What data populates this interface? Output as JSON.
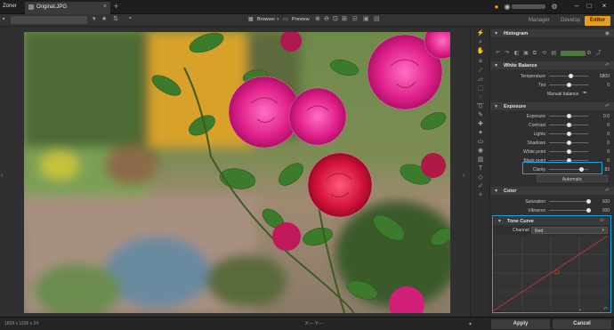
{
  "app": {
    "name": "Zoner"
  },
  "tab": {
    "title": "Original.JPG"
  },
  "toolbar": {
    "browser": "Browser",
    "preview": "Preview"
  },
  "modes": [
    "Manager",
    "Develop",
    "Editor"
  ],
  "panel": {
    "histogram": {
      "title": "Histogram"
    },
    "white_balance": {
      "title": "White Balance",
      "rows": [
        {
          "label": "Temperature",
          "value": "5800",
          "fraction": 0.55
        },
        {
          "label": "Tint",
          "value": "0",
          "fraction": 0.5
        }
      ],
      "manual": "Manual balance"
    },
    "exposure": {
      "title": "Exposure",
      "rows": [
        {
          "label": "Exposure",
          "value": "0.0",
          "fraction": 0.5
        },
        {
          "label": "Contrast",
          "value": "0",
          "fraction": 0.5
        },
        {
          "label": "Lights",
          "value": "0",
          "fraction": 0.5
        },
        {
          "label": "Shadows",
          "value": "0",
          "fraction": 0.5
        },
        {
          "label": "White point",
          "value": "0",
          "fraction": 0.5
        },
        {
          "label": "Black point",
          "value": "0",
          "fraction": 0.5
        },
        {
          "label": "Clarity",
          "value": "83",
          "fraction": 0.83
        }
      ],
      "automatic": "Automatic"
    },
    "color": {
      "title": "Color",
      "rows": [
        {
          "label": "Saturation",
          "value": "100",
          "fraction": 1.0
        },
        {
          "label": "Vibrance",
          "value": "100",
          "fraction": 1.0
        }
      ]
    },
    "tone_curve": {
      "title": "Tone Curve",
      "channel_label": "Channel",
      "channel_value": "Red"
    }
  },
  "status": {
    "dimensions": "1659 x 1106 x 24",
    "coords": "X:--- Y:---"
  },
  "buttons": {
    "apply": "Apply",
    "cancel": "Cancel"
  },
  "colors": {
    "accent": "#e8a01a",
    "highlight": "#1fa3d9",
    "curve": "#c0392b"
  }
}
